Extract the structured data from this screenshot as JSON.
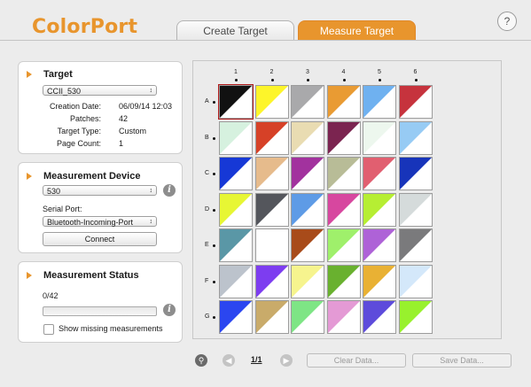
{
  "app": {
    "name": "ColorPort"
  },
  "tabs": [
    {
      "label": "Create Target",
      "active": false
    },
    {
      "label": "Measure Target",
      "active": true
    }
  ],
  "help_label": "?",
  "target": {
    "title": "Target",
    "selected": "CCII_530",
    "fields": [
      {
        "label": "Creation Date:",
        "value": "06/09/14 12:03"
      },
      {
        "label": "Patches:",
        "value": "42"
      },
      {
        "label": "Target Type:",
        "value": "Custom"
      },
      {
        "label": "Page Count:",
        "value": "1"
      }
    ]
  },
  "device": {
    "title": "Measurement Device",
    "selected": "530",
    "serial_label": "Serial Port:",
    "serial_value": "Bluetooth-Incoming-Port",
    "connect_label": "Connect",
    "info_label": "i"
  },
  "status": {
    "title": "Measurement Status",
    "progress_text": "0/42",
    "progress_fraction": 0,
    "checkbox_label": "Show missing measurements",
    "checkbox_checked": false,
    "info_label": "i"
  },
  "grid": {
    "columns": [
      "1",
      "2",
      "3",
      "4",
      "5",
      "6"
    ],
    "rows": [
      {
        "label": "A",
        "colors": [
          "#111111",
          "#fdf52a",
          "#a9a9ab",
          "#e99b33",
          "#6fb1f0",
          "#c6333d"
        ]
      },
      {
        "label": "B",
        "colors": [
          "#d6f1df",
          "#d64127",
          "#e9dcb2",
          "#7b2450",
          "#edf7ee",
          "#97cbf4"
        ]
      },
      {
        "label": "C",
        "colors": [
          "#1638d6",
          "#e6bb8c",
          "#a2329e",
          "#b8bc97",
          "#e15f70",
          "#1734ba"
        ]
      },
      {
        "label": "D",
        "colors": [
          "#e7f634",
          "#54565c",
          "#5e9be6",
          "#d7479f",
          "#b6ee33",
          "#d5dbdb"
        ]
      },
      {
        "label": "E",
        "colors": [
          "#5a97a6",
          "#ffffff",
          "#a84b1a",
          "#9ff06b",
          "#ae62d7",
          "#7a7a7c"
        ]
      },
      {
        "label": "F",
        "colors": [
          "#bcc3cc",
          "#7d3df0",
          "#f6f48e",
          "#69b12f",
          "#e9b134",
          "#d4e8fa"
        ]
      },
      {
        "label": "G",
        "colors": [
          "#2b46f0",
          "#c9ab6a",
          "#7ee585",
          "#e49ad5",
          "#5d4bdb",
          "#98f12d"
        ]
      }
    ]
  },
  "bottom": {
    "page_indicator": "1/1",
    "clear_label": "Clear Data...",
    "save_label": "Save Data...",
    "zoom_icon": "magnifier-icon",
    "prev_icon": "arrow-left-icon",
    "next_icon": "arrow-right-icon"
  },
  "colors": {
    "accent": "#e8952d",
    "selection": "#b11a1a"
  }
}
